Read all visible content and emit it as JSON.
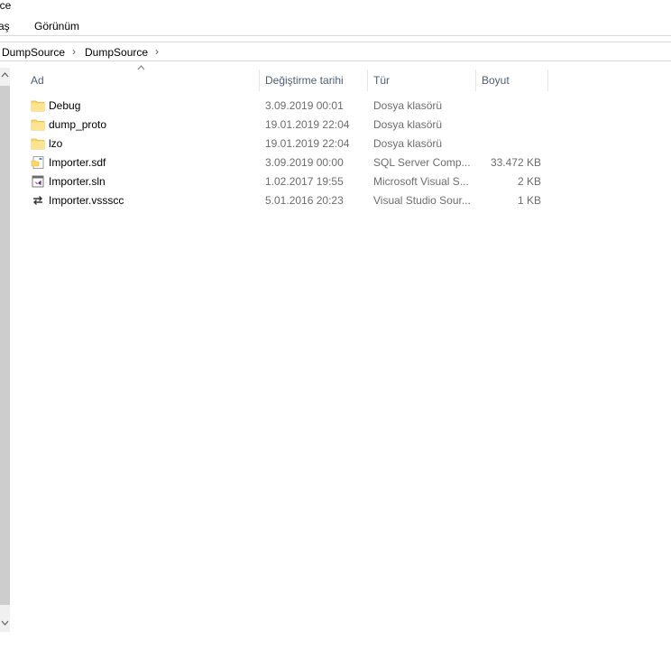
{
  "window": {
    "title_fragment": "urce"
  },
  "ribbon": {
    "tab_partial": "aş",
    "tab_view": "Görünüm"
  },
  "address": {
    "crumb1": "DumpSource",
    "crumb2": "DumpSource",
    "sep": "›"
  },
  "columns": {
    "name": "Ad",
    "modified": "Değiştirme tarihi",
    "type": "Tür",
    "size": "Boyut",
    "sort_indicator": "^"
  },
  "files": [
    {
      "name": "Debug",
      "modified": "3.09.2019 00:01",
      "type": "Dosya klasörü",
      "size": "",
      "icon": "folder-icon"
    },
    {
      "name": "dump_proto",
      "modified": "19.01.2019 22:04",
      "type": "Dosya klasörü",
      "size": "",
      "icon": "folder-icon"
    },
    {
      "name": "lzo",
      "modified": "19.01.2019 22:04",
      "type": "Dosya klasörü",
      "size": "",
      "icon": "folder-icon"
    },
    {
      "name": "Importer.sdf",
      "modified": "3.09.2019 00:00",
      "type": "SQL Server Comp...",
      "size": "33.472 KB",
      "icon": "sdf-file-icon"
    },
    {
      "name": "Importer.sln",
      "modified": "1.02.2017 19:55",
      "type": "Microsoft Visual S...",
      "size": "2 KB",
      "icon": "visual-studio-solution-icon"
    },
    {
      "name": "Importer.vssscc",
      "modified": "5.01.2016 20:23",
      "type": "Visual Studio Sour...",
      "size": "1 KB",
      "icon": "source-control-file-icon"
    }
  ],
  "colors": {
    "header_text": "#4c607a",
    "detail_text": "#6d6d6d",
    "folder_yellow": "#ffd76a",
    "vs_purple": "#68217a"
  }
}
